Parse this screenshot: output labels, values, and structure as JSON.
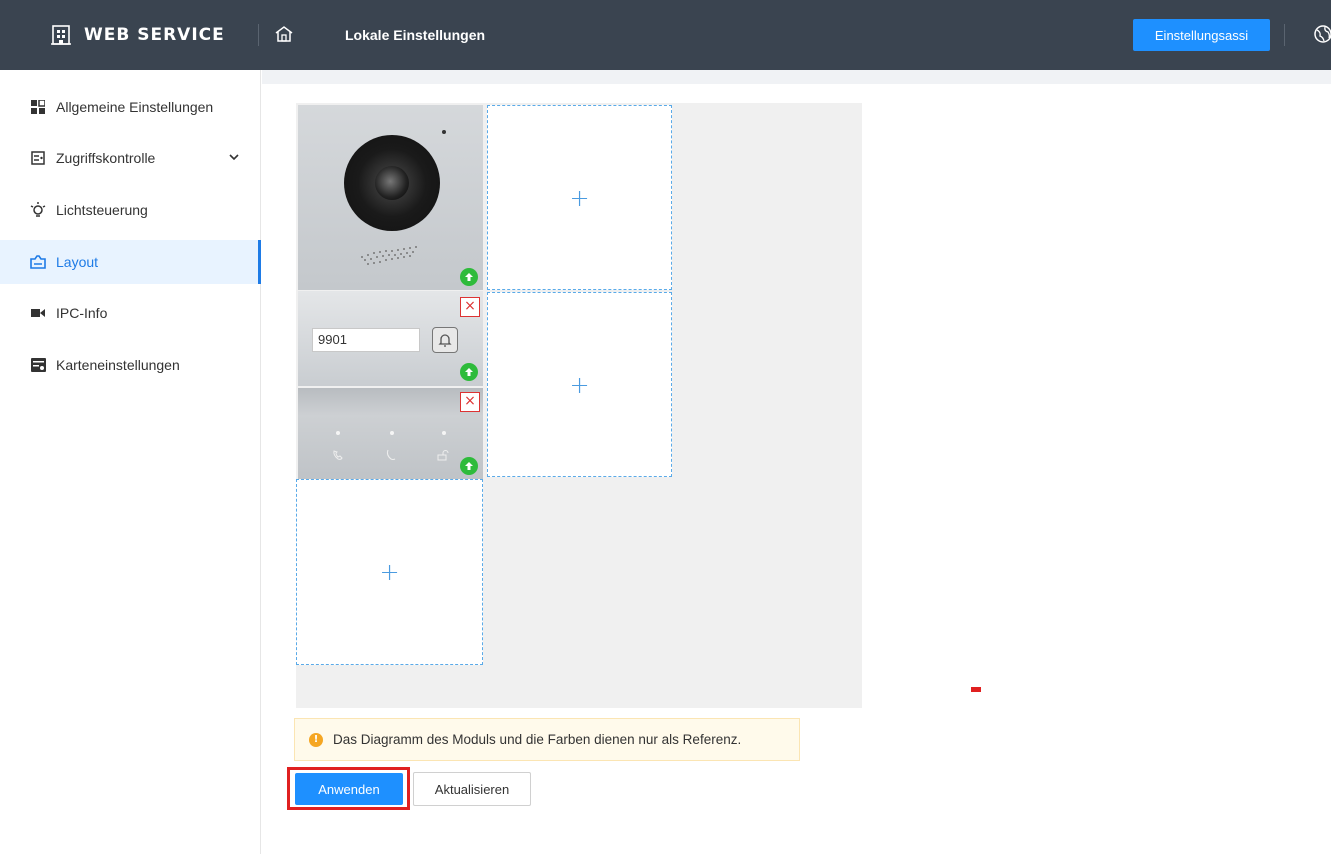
{
  "header": {
    "brand": "WEB SERVICE",
    "page_title": "Lokale Einstellungen",
    "wizard_button": "Einstellungsassi",
    "accent": "#1e90ff",
    "background": "#3a4450"
  },
  "sidebar": {
    "items": [
      {
        "label": "Allgemeine Einstellungen",
        "icon": "grid-icon"
      },
      {
        "label": "Zugriffskontrolle",
        "icon": "access-control-icon",
        "expandable": true
      },
      {
        "label": "Lichtsteuerung",
        "icon": "lightbulb-icon"
      },
      {
        "label": "Layout",
        "icon": "layout-icon",
        "active": true
      },
      {
        "label": "IPC-Info",
        "icon": "camera-icon"
      },
      {
        "label": "Karteneinstellungen",
        "icon": "card-settings-icon"
      }
    ]
  },
  "layout_editor": {
    "camera_module": {
      "icon": "camera-lens-icon"
    },
    "keypad_module": {
      "room_number": "9901"
    },
    "button_module": {
      "icons": [
        "phone-icon",
        "call-icon",
        "unlock-icon"
      ]
    },
    "empty_slot_symbol": "+",
    "delete_symbol": "×"
  },
  "notice": {
    "text": "Das Diagramm des Moduls und die Farben dienen nur als Referenz.",
    "icon_text": "!"
  },
  "actions": {
    "apply": "Anwenden",
    "refresh": "Aktualisieren"
  }
}
